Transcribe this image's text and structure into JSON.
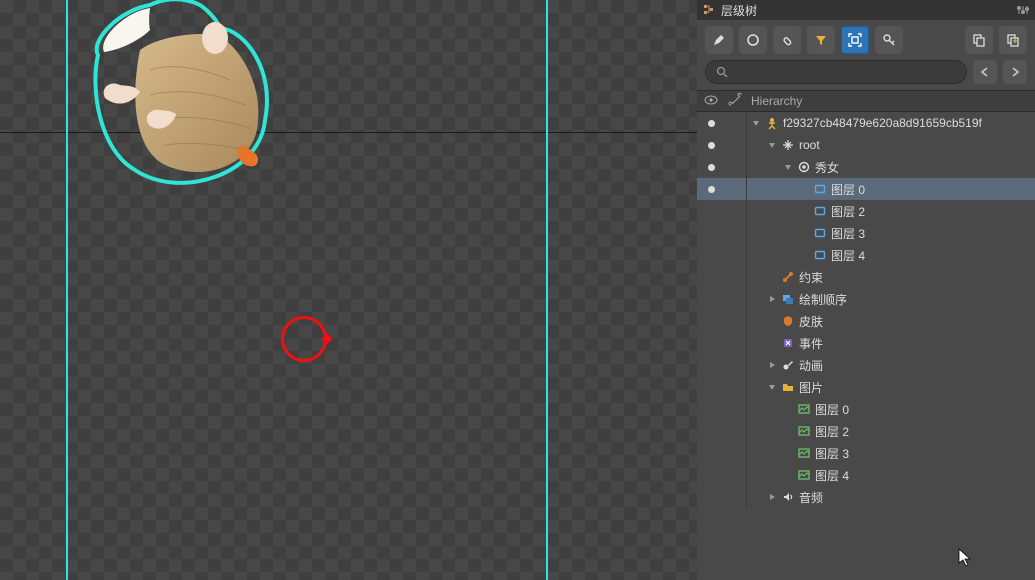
{
  "panel": {
    "title": "层级树",
    "hierarchy_header": "Hierarchy"
  },
  "search": {
    "placeholder": ""
  },
  "toolbar": {
    "edit": "edit",
    "circle": "circle",
    "attach": "attachment",
    "filter": "filter",
    "target": "target",
    "key": "key",
    "copy": "copy",
    "paste": "paste",
    "back": "back",
    "forward": "forward"
  },
  "tree": {
    "rows": [
      {
        "indent": 0,
        "expand": "down",
        "icon": "skeleton",
        "label": "f29327cb48479e620a8d91659cb519f",
        "dot": true,
        "sel": false
      },
      {
        "indent": 1,
        "expand": "down",
        "icon": "root",
        "label": "root",
        "dot": true,
        "sel": false
      },
      {
        "indent": 2,
        "expand": "down",
        "icon": "bone",
        "label": "秀女",
        "dot": true,
        "sel": false
      },
      {
        "indent": 3,
        "expand": "none",
        "icon": "slot",
        "label": "图层 0",
        "dot": true,
        "sel": true
      },
      {
        "indent": 3,
        "expand": "none",
        "icon": "slot",
        "label": "图层 2",
        "dot": false,
        "sel": false
      },
      {
        "indent": 3,
        "expand": "none",
        "icon": "slot",
        "label": "图层 3",
        "dot": false,
        "sel": false
      },
      {
        "indent": 3,
        "expand": "none",
        "icon": "slot",
        "label": "图层 4",
        "dot": false,
        "sel": false
      },
      {
        "indent": 1,
        "expand": "none",
        "icon": "constraint",
        "label": "约束",
        "dot": false,
        "sel": false
      },
      {
        "indent": 1,
        "expand": "right",
        "icon": "draworder",
        "label": "绘制顺序",
        "dot": false,
        "sel": false
      },
      {
        "indent": 1,
        "expand": "none",
        "icon": "skin",
        "label": "皮肤",
        "dot": false,
        "sel": false
      },
      {
        "indent": 1,
        "expand": "none",
        "icon": "event",
        "label": "事件",
        "dot": false,
        "sel": false
      },
      {
        "indent": 1,
        "expand": "right",
        "icon": "anim",
        "label": "动画",
        "dot": false,
        "sel": false
      },
      {
        "indent": 1,
        "expand": "down",
        "icon": "folder",
        "label": "图片",
        "dot": false,
        "sel": false
      },
      {
        "indent": 2,
        "expand": "none",
        "icon": "image",
        "label": "图层 0",
        "dot": false,
        "sel": false
      },
      {
        "indent": 2,
        "expand": "none",
        "icon": "image",
        "label": "图层 2",
        "dot": false,
        "sel": false
      },
      {
        "indent": 2,
        "expand": "none",
        "icon": "image",
        "label": "图层 3",
        "dot": false,
        "sel": false
      },
      {
        "indent": 2,
        "expand": "none",
        "icon": "image",
        "label": "图层 4",
        "dot": false,
        "sel": false
      },
      {
        "indent": 1,
        "expand": "right",
        "icon": "audio",
        "label": "音频",
        "dot": false,
        "sel": false
      }
    ]
  },
  "colors": {
    "accent": "#2e74b5",
    "selection_outline": "#2fe6d6",
    "gizmo": "#e11"
  }
}
